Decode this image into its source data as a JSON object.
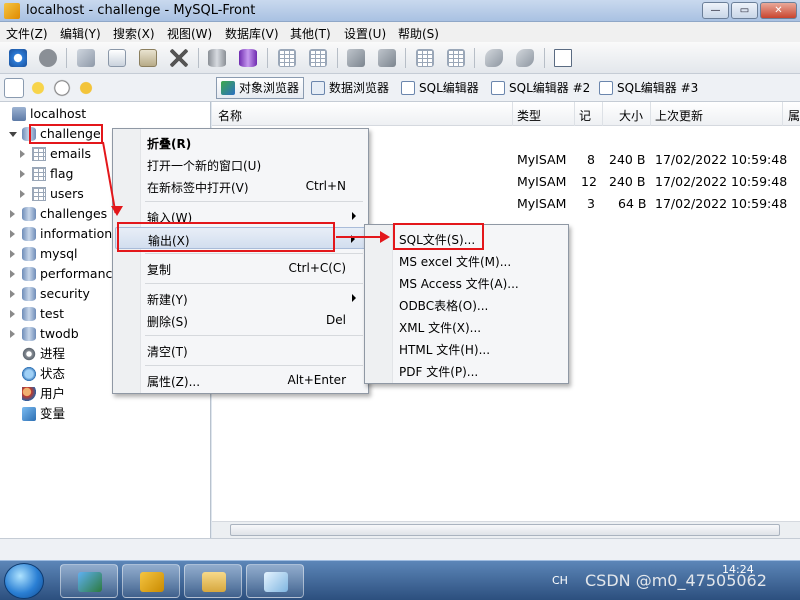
{
  "window": {
    "title": "localhost - challenge - MySQL-Front"
  },
  "menubar": [
    "文件(Z)",
    "编辑(Y)",
    "搜索(X)",
    "视图(W)",
    "数据库(V)",
    "其他(T)",
    "设置(U)",
    "帮助(S)"
  ],
  "viewbar": {
    "tabs": [
      "对象浏览器",
      "数据浏览器",
      "SQL编辑器",
      "SQL编辑器 #2",
      "SQL编辑器 #3"
    ],
    "active_tab": "对象浏览器"
  },
  "tree": {
    "host": "localhost",
    "selected_db": "challenge",
    "tables": [
      "emails",
      "flag",
      "users"
    ],
    "databases": [
      "challenges",
      "information_",
      "mysql",
      "performance_",
      "security",
      "test",
      "twodb"
    ],
    "extras": [
      "进程",
      "状态",
      "用户",
      "变量"
    ]
  },
  "list": {
    "columns": [
      "名称",
      "类型",
      "记",
      "大小",
      "上次更新",
      "属"
    ],
    "rows": [
      {
        "type": "MyISAM",
        "records": "8",
        "size": "240 B",
        "updated": "17/02/2022 10:59:48"
      },
      {
        "type": "MyISAM",
        "records": "12",
        "size": "240 B",
        "updated": "17/02/2022 10:59:48"
      },
      {
        "type": "MyISAM",
        "records": "3",
        "size": "64 B",
        "updated": "17/02/2022 10:59:48"
      }
    ]
  },
  "context_menu": {
    "items": [
      {
        "label": "折叠(R)",
        "shortcut": ""
      },
      {
        "label": "打开一个新的窗口(U)",
        "shortcut": ""
      },
      {
        "label": "在新标签中打开(V)",
        "shortcut": "Ctrl+N"
      },
      {
        "label": "输入(W)",
        "shortcut": ""
      },
      {
        "label": "输出(X)",
        "shortcut": ""
      },
      {
        "label": "复制",
        "shortcut": "Ctrl+C(C)"
      },
      {
        "label": "新建(Y)",
        "shortcut": ""
      },
      {
        "label": "删除(S)",
        "shortcut": "Del"
      },
      {
        "label": "清空(T)",
        "shortcut": ""
      },
      {
        "label": "属性(Z)...",
        "shortcut": "Alt+Enter"
      }
    ]
  },
  "export_submenu": {
    "items": [
      "SQL文件(S)...",
      "MS excel 文件(M)...",
      "MS Access 文件(A)...",
      "ODBC表格(O)...",
      "XML 文件(X)...",
      "HTML 文件(H)...",
      "PDF 文件(P)..."
    ]
  },
  "taskbar": {
    "tray_text": "CH",
    "clock": "14:24",
    "watermark": "CSDN @m0_47505062"
  },
  "colors": {
    "annotation_red": "#e3171b",
    "selection_blue": "#d2deef"
  }
}
